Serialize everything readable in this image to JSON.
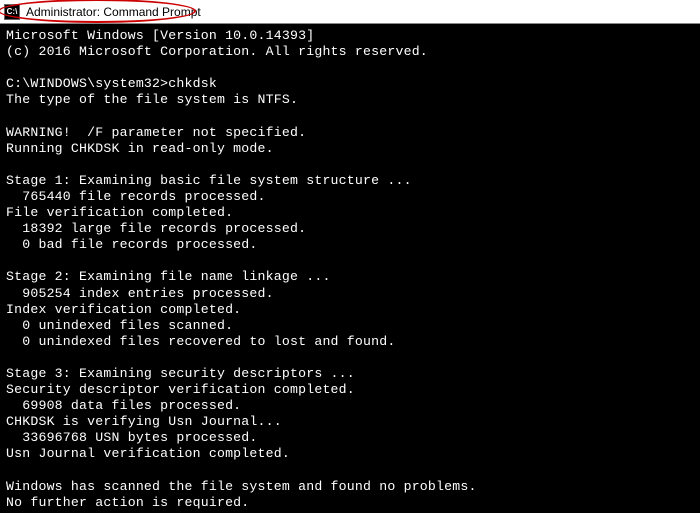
{
  "titlebar": {
    "icon_label": "C:\\",
    "text": "Administrator: Command Prompt"
  },
  "console": {
    "line01": "Microsoft Windows [Version 10.0.14393]",
    "line02": "(c) 2016 Microsoft Corporation. All rights reserved.",
    "blank1": "",
    "prompt": "C:\\WINDOWS\\system32>",
    "command": "chkdsk",
    "line03": "The type of the file system is NTFS.",
    "blank2": "",
    "line04": "WARNING!  /F parameter not specified.",
    "line05": "Running CHKDSK in read-only mode.",
    "blank3": "",
    "line06": "Stage 1: Examining basic file system structure ...",
    "line07": "  765440 file records processed.",
    "line08": "File verification completed.",
    "line09": "  18392 large file records processed.",
    "line10": "  0 bad file records processed.",
    "blank4": "",
    "line11": "Stage 2: Examining file name linkage ...",
    "line12": "  905254 index entries processed.",
    "line13": "Index verification completed.",
    "line14": "  0 unindexed files scanned.",
    "line15": "  0 unindexed files recovered to lost and found.",
    "blank5": "",
    "line16": "Stage 3: Examining security descriptors ...",
    "line17": "Security descriptor verification completed.",
    "line18": "  69908 data files processed.",
    "line19": "CHKDSK is verifying Usn Journal...",
    "line20": "  33696768 USN bytes processed.",
    "line21": "Usn Journal verification completed.",
    "blank6": "",
    "line22": "Windows has scanned the file system and found no problems.",
    "line23": "No further action is required."
  }
}
